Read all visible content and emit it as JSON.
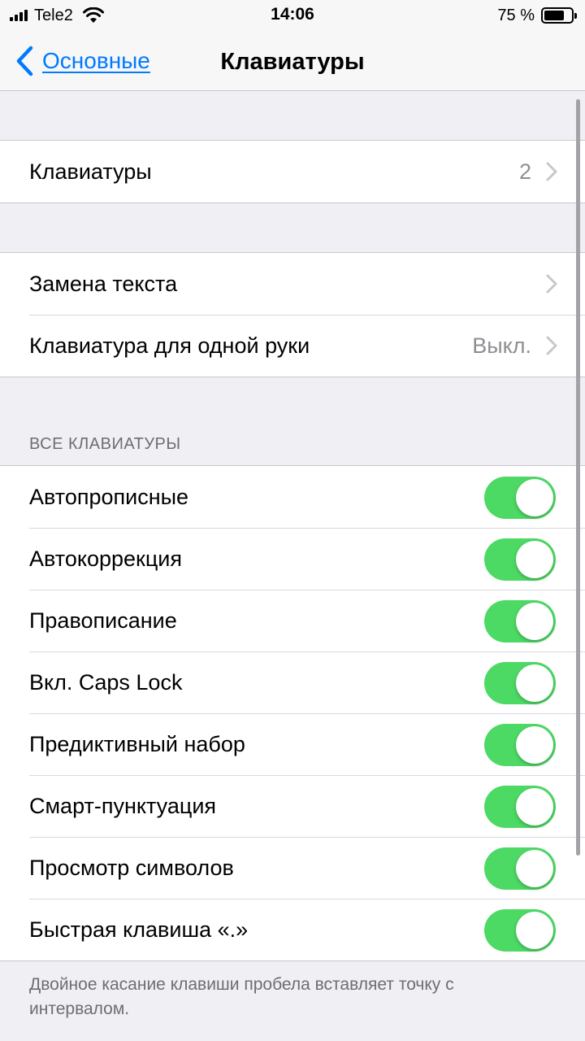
{
  "status_bar": {
    "carrier": "Tele2",
    "time": "14:06",
    "battery_percent": "75 %",
    "battery_level": 0.75
  },
  "nav": {
    "back_label": "Основные",
    "title": "Клавиатуры"
  },
  "group1": {
    "keyboards": {
      "label": "Клавиатуры",
      "value": "2"
    }
  },
  "group2": {
    "text_replacement": {
      "label": "Замена текста"
    },
    "one_handed": {
      "label": "Клавиатура для одной руки",
      "value": "Выкл."
    }
  },
  "all_keyboards": {
    "header": "ВСЕ КЛАВИАТУРЫ",
    "items": [
      {
        "label": "Автопрописные",
        "on": true
      },
      {
        "label": "Автокоррекция",
        "on": true
      },
      {
        "label": "Правописание",
        "on": true
      },
      {
        "label": "Вкл. Caps Lock",
        "on": true
      },
      {
        "label": "Предиктивный набор",
        "on": true
      },
      {
        "label": "Смарт-пунктуация",
        "on": true
      },
      {
        "label": "Просмотр символов",
        "on": true
      },
      {
        "label": "Быстрая клавиша «.»",
        "on": true
      }
    ],
    "footer": "Двойное касание клавиши пробела вставляет точку с интервалом."
  },
  "colors": {
    "accent": "#007aff",
    "toggle_on": "#4cd964",
    "background": "#efeff4"
  },
  "icons": {
    "back": "chevron-left-icon",
    "disclosure": "chevron-right-icon",
    "signal": "cellular-signal-icon",
    "wifi": "wifi-icon",
    "battery": "battery-icon"
  }
}
